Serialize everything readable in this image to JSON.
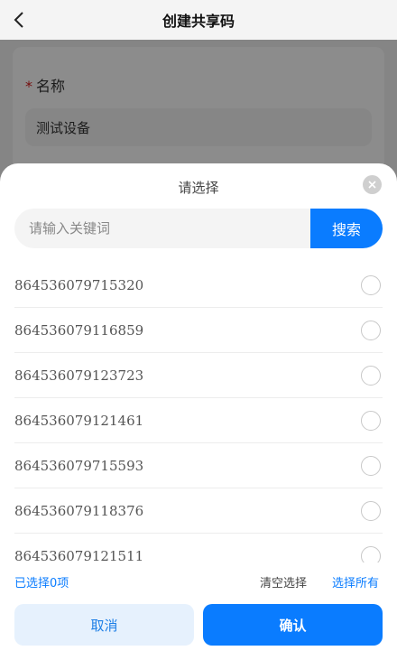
{
  "header": {
    "title": "创建共享码",
    "back_icon": "back-arrow-icon"
  },
  "form": {
    "name_required_mark": "*",
    "name_label": "名称",
    "name_value": "测试设备"
  },
  "picker": {
    "title": "请选择",
    "close_icon": "close-icon",
    "search_placeholder": "请输入关键词",
    "search_button": "搜索",
    "items": [
      {
        "label": "864536079715320",
        "selected": false
      },
      {
        "label": "864536079116859",
        "selected": false
      },
      {
        "label": "864536079123723",
        "selected": false
      },
      {
        "label": "864536079121461",
        "selected": false
      },
      {
        "label": "864536079715593",
        "selected": false
      },
      {
        "label": "864536079118376",
        "selected": false
      },
      {
        "label": "864536079121511",
        "selected": false
      }
    ],
    "summary": "已选择0项",
    "clear_selection": "清空选择",
    "select_all": "选择所有",
    "cancel_button": "取消",
    "confirm_button": "确认"
  },
  "colors": {
    "accent": "#0a7cff",
    "accent_light": "#e6f1fd",
    "required": "#d61b1b"
  }
}
